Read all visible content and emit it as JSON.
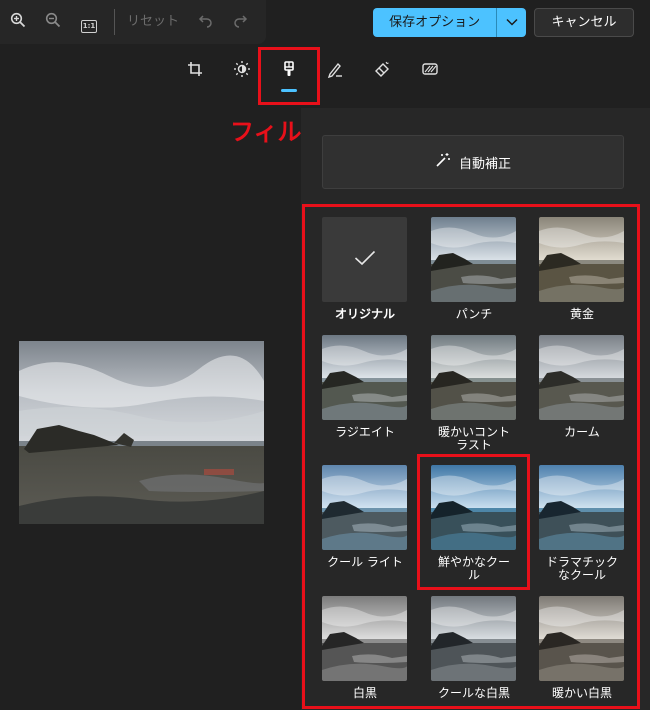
{
  "toolbar": {
    "zoom_in_icon": "zoom-in-icon",
    "zoom_out_icon": "zoom-out-icon",
    "actual_size_label": "1:1",
    "reset_label": "リセット",
    "undo_icon": "undo-icon",
    "redo_icon": "redo-icon",
    "save_label": "保存オプション",
    "cancel_label": "キャンセル"
  },
  "tools": [
    "crop-icon",
    "brightness-icon",
    "filter-icon",
    "markup-icon",
    "erase-icon",
    "background-icon"
  ],
  "annotation": {
    "label": "フィルター",
    "color": "#e8101a"
  },
  "panel": {
    "auto_enhance_label": "自動補正",
    "filters": [
      {
        "name": "オリジナル",
        "style": "original"
      },
      {
        "name": "パンチ",
        "style": "punch"
      },
      {
        "name": "黄金",
        "style": "golden"
      },
      {
        "name": "ラジエイト",
        "style": "radiate"
      },
      {
        "name": "暖かいコント\nラスト",
        "style": "warm"
      },
      {
        "name": "カーム",
        "style": "calm"
      },
      {
        "name": "クール ライト",
        "style": "coollight"
      },
      {
        "name": "鮮やかなクー\nル",
        "style": "vivid"
      },
      {
        "name": "ドラマチック\nなクール",
        "style": "dramatic"
      },
      {
        "name": "白黒",
        "style": "bw"
      },
      {
        "name": "クールな白黒",
        "style": "coolbw"
      },
      {
        "name": "暖かい白黒",
        "style": "warmbw"
      }
    ]
  },
  "colors": {
    "accent": "#4cc2ff",
    "annotation": "#e8101a",
    "panel": "#272727",
    "background": "#202020"
  }
}
